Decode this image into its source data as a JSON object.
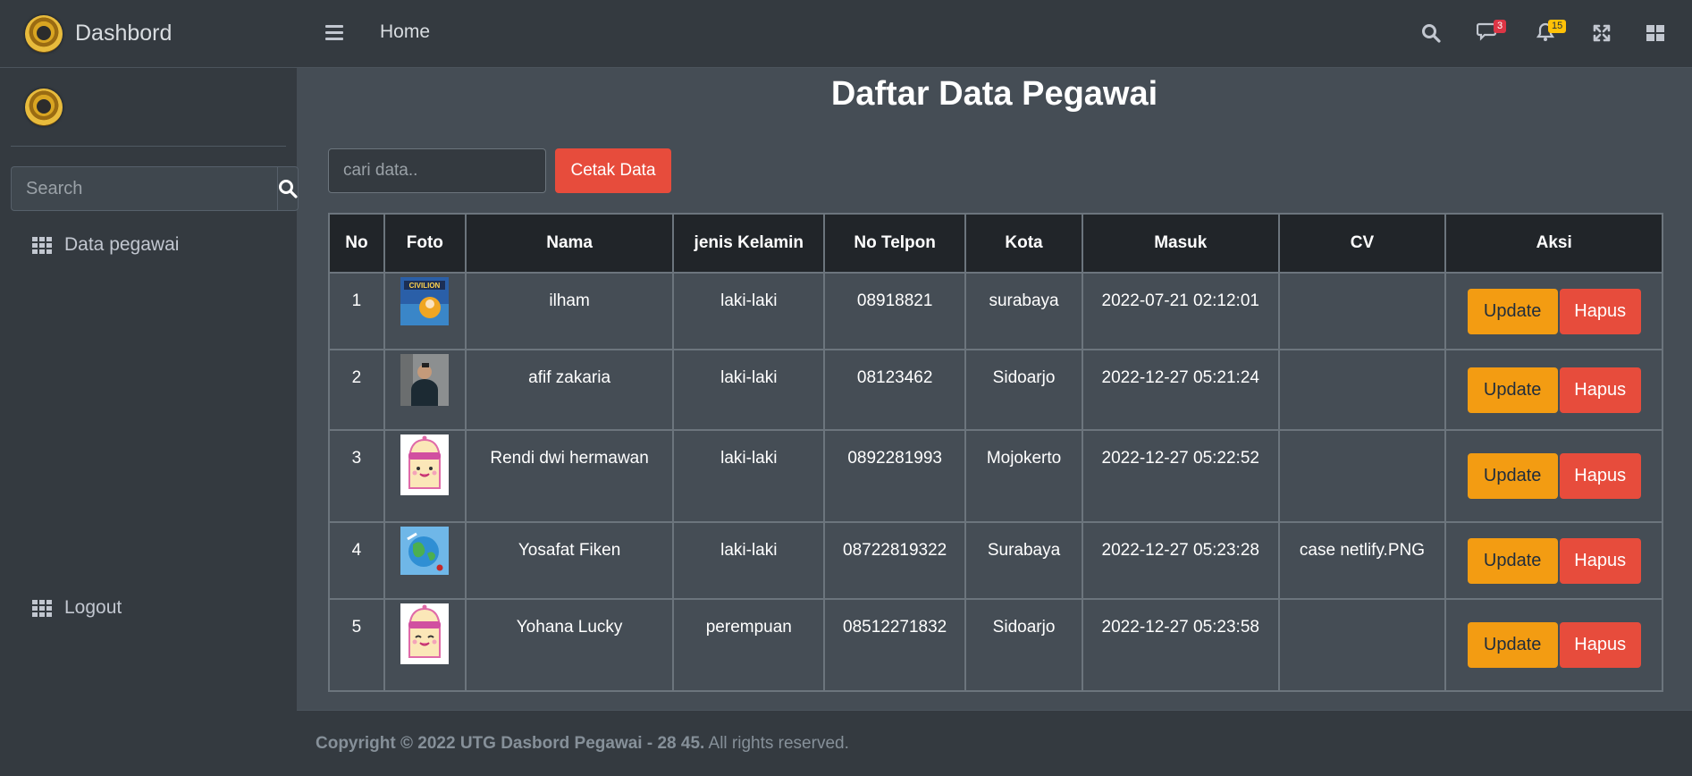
{
  "sidebar": {
    "brand": "Dashbord",
    "search_placeholder": "Search",
    "nav_data": "Data pegawai",
    "nav_logout": "Logout"
  },
  "topbar": {
    "home": "Home",
    "messages_count": "3",
    "notifications_count": "15"
  },
  "page": {
    "title": "Daftar Data Pegawai",
    "search_placeholder": "cari data..",
    "print_label": "Cetak Data"
  },
  "table": {
    "headers": [
      "No",
      "Foto",
      "Nama",
      "jenis Kelamin",
      "No Telpon",
      "Kota",
      "Masuk",
      "CV",
      "Aksi"
    ],
    "rows": [
      {
        "no": "1",
        "nama": "ilham",
        "jk": "laki-laki",
        "telp": "08918821",
        "kota": "surabaya",
        "masuk": "2022-07-21 02:12:01",
        "cv": "",
        "foto": "civilion-poster"
      },
      {
        "no": "2",
        "nama": "afif zakaria",
        "jk": "laki-laki",
        "telp": "08123462",
        "kota": "Sidoarjo",
        "masuk": "2022-12-27 05:21:24",
        "cv": "",
        "foto": "person-photo"
      },
      {
        "no": "3",
        "nama": "Rendi dwi hermawan",
        "jk": "laki-laki",
        "telp": "0892281993",
        "kota": "Mojokerto",
        "masuk": "2022-12-27 05:22:52",
        "cv": "",
        "foto": "cartoon-character"
      },
      {
        "no": "4",
        "nama": "Yosafat Fiken",
        "jk": "laki-laki",
        "telp": "08722819322",
        "kota": "Surabaya",
        "masuk": "2022-12-27 05:23:28",
        "cv": "case netlify.PNG",
        "foto": "globe-illustration"
      },
      {
        "no": "5",
        "nama": "Yohana Lucky",
        "jk": "perempuan",
        "telp": "08512271832",
        "kota": "Sidoarjo",
        "masuk": "2022-12-27 05:23:58",
        "cv": "",
        "foto": "cartoon-character"
      }
    ],
    "update_label": "Update",
    "delete_label": "Hapus"
  },
  "footer": {
    "copyright": "Copyright © 2022 UTG Dasbord Pegawai - 28 45.",
    "rights": " All rights reserved."
  }
}
